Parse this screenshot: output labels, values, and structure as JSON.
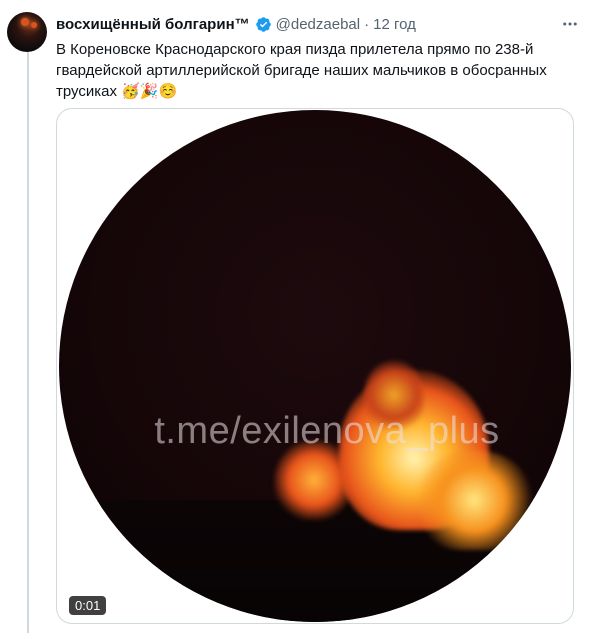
{
  "tweet": {
    "display_name": "восхищённый болгарин™",
    "handle": "@dedzaebal",
    "separator": "·",
    "time": "12 год",
    "text": "В Кореновске Краснодарского края пизда прилетела прямо по 238-й гвардейской артиллерийской бригаде наших мальчиков в обосранных трусиках",
    "emojis": "🥳🎉☺️"
  },
  "media": {
    "watermark": "t.me/exilenova_plus",
    "duration": "0:01"
  },
  "icons": {
    "verified": "verified-badge-icon",
    "more": "more-options-icon"
  },
  "colors": {
    "verified": "#1d9bf0",
    "secondary_text": "#536471",
    "border": "#cfd9de"
  }
}
